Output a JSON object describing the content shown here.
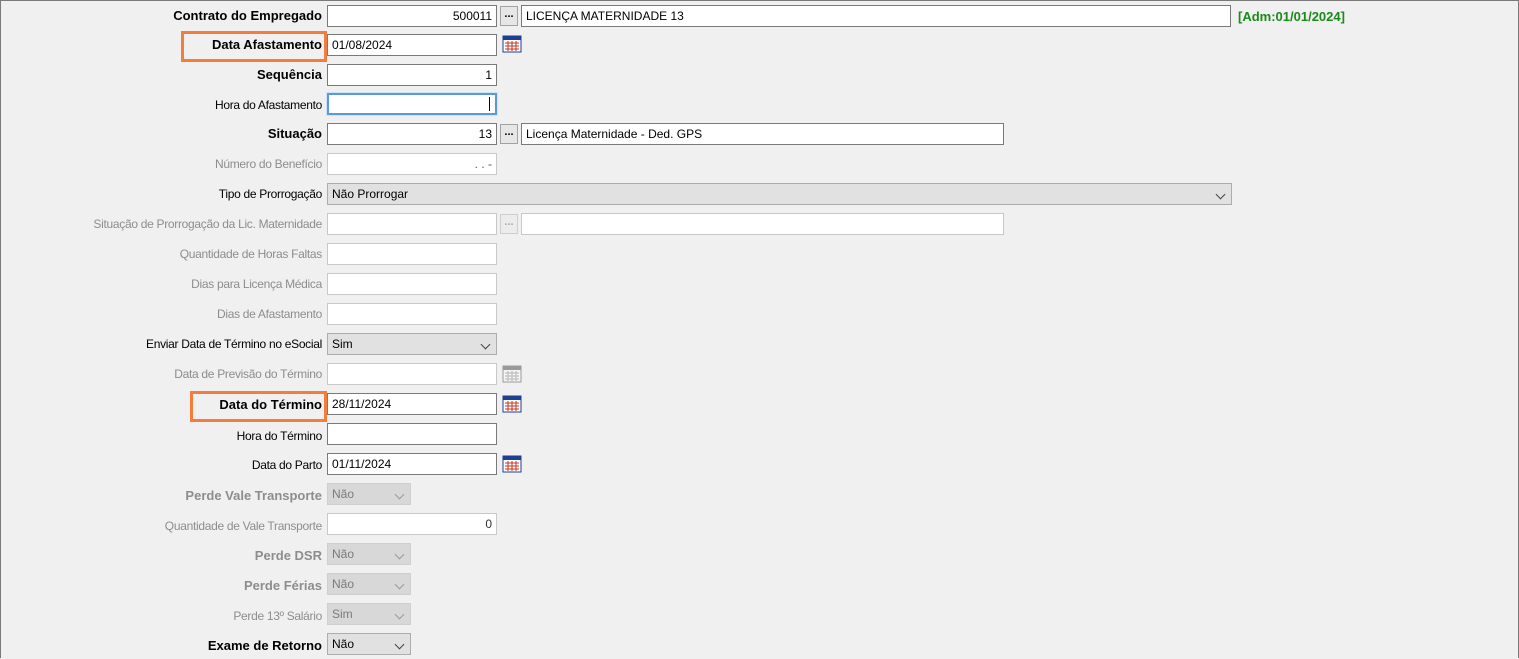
{
  "adm_label": "[Adm:01/01/2024]",
  "fields": {
    "contrato": {
      "label": "Contrato do Empregado",
      "code": "500011",
      "desc": "LICENÇA MATERNIDADE 13"
    },
    "data_afastamento": {
      "label": "Data Afastamento",
      "value": "01/08/2024"
    },
    "sequencia": {
      "label": "Sequência",
      "value": "1"
    },
    "hora_afastamento": {
      "label": "Hora do Afastamento",
      "value": ""
    },
    "situacao": {
      "label": "Situação",
      "code": "13",
      "desc": "Licença Maternidade - Ded. GPS"
    },
    "numero_beneficio": {
      "label": "Número do Benefício",
      "value": ". . -"
    },
    "tipo_prorrogacao": {
      "label": "Tipo de Prorrogação",
      "value": "Não Prorrogar"
    },
    "situacao_prorrogacao": {
      "label": "Situação de Prorrogação da Lic. Maternidade",
      "code": "",
      "desc": ""
    },
    "qtd_horas_faltas": {
      "label": "Quantidade de Horas Faltas",
      "value": ""
    },
    "dias_licenca_medica": {
      "label": "Dias para Licença Médica",
      "value": ""
    },
    "dias_afastamento": {
      "label": "Dias de Afastamento",
      "value": ""
    },
    "enviar_data_termino": {
      "label": "Enviar Data de Término no eSocial",
      "value": "Sim"
    },
    "data_previsao_termino": {
      "label": "Data de Previsão do Término",
      "value": ""
    },
    "data_termino": {
      "label": "Data do Término",
      "value": "28/11/2024"
    },
    "hora_termino": {
      "label": "Hora do Término",
      "value": ""
    },
    "data_parto": {
      "label": "Data do Parto",
      "value": "01/11/2024"
    },
    "perde_vale_transporte": {
      "label": "Perde Vale Transporte",
      "value": "Não"
    },
    "qtd_vale_transporte": {
      "label": "Quantidade de Vale Transporte",
      "value": "0"
    },
    "perde_dsr": {
      "label": "Perde DSR",
      "value": "Não"
    },
    "perde_ferias": {
      "label": "Perde Férias",
      "value": "Não"
    },
    "perde_13_salario": {
      "label": "Perde 13º Salário",
      "value": "Sim"
    },
    "exame_retorno": {
      "label": "Exame de Retorno",
      "value": "Não"
    }
  },
  "ellipsis_label": "...",
  "colors": {
    "highlight": "#f47c3c",
    "adm_green": "#1a8a1a",
    "focus_blue": "#5b9bd5"
  },
  "icons": [
    "calendar-icon",
    "chevron-down-icon"
  ]
}
